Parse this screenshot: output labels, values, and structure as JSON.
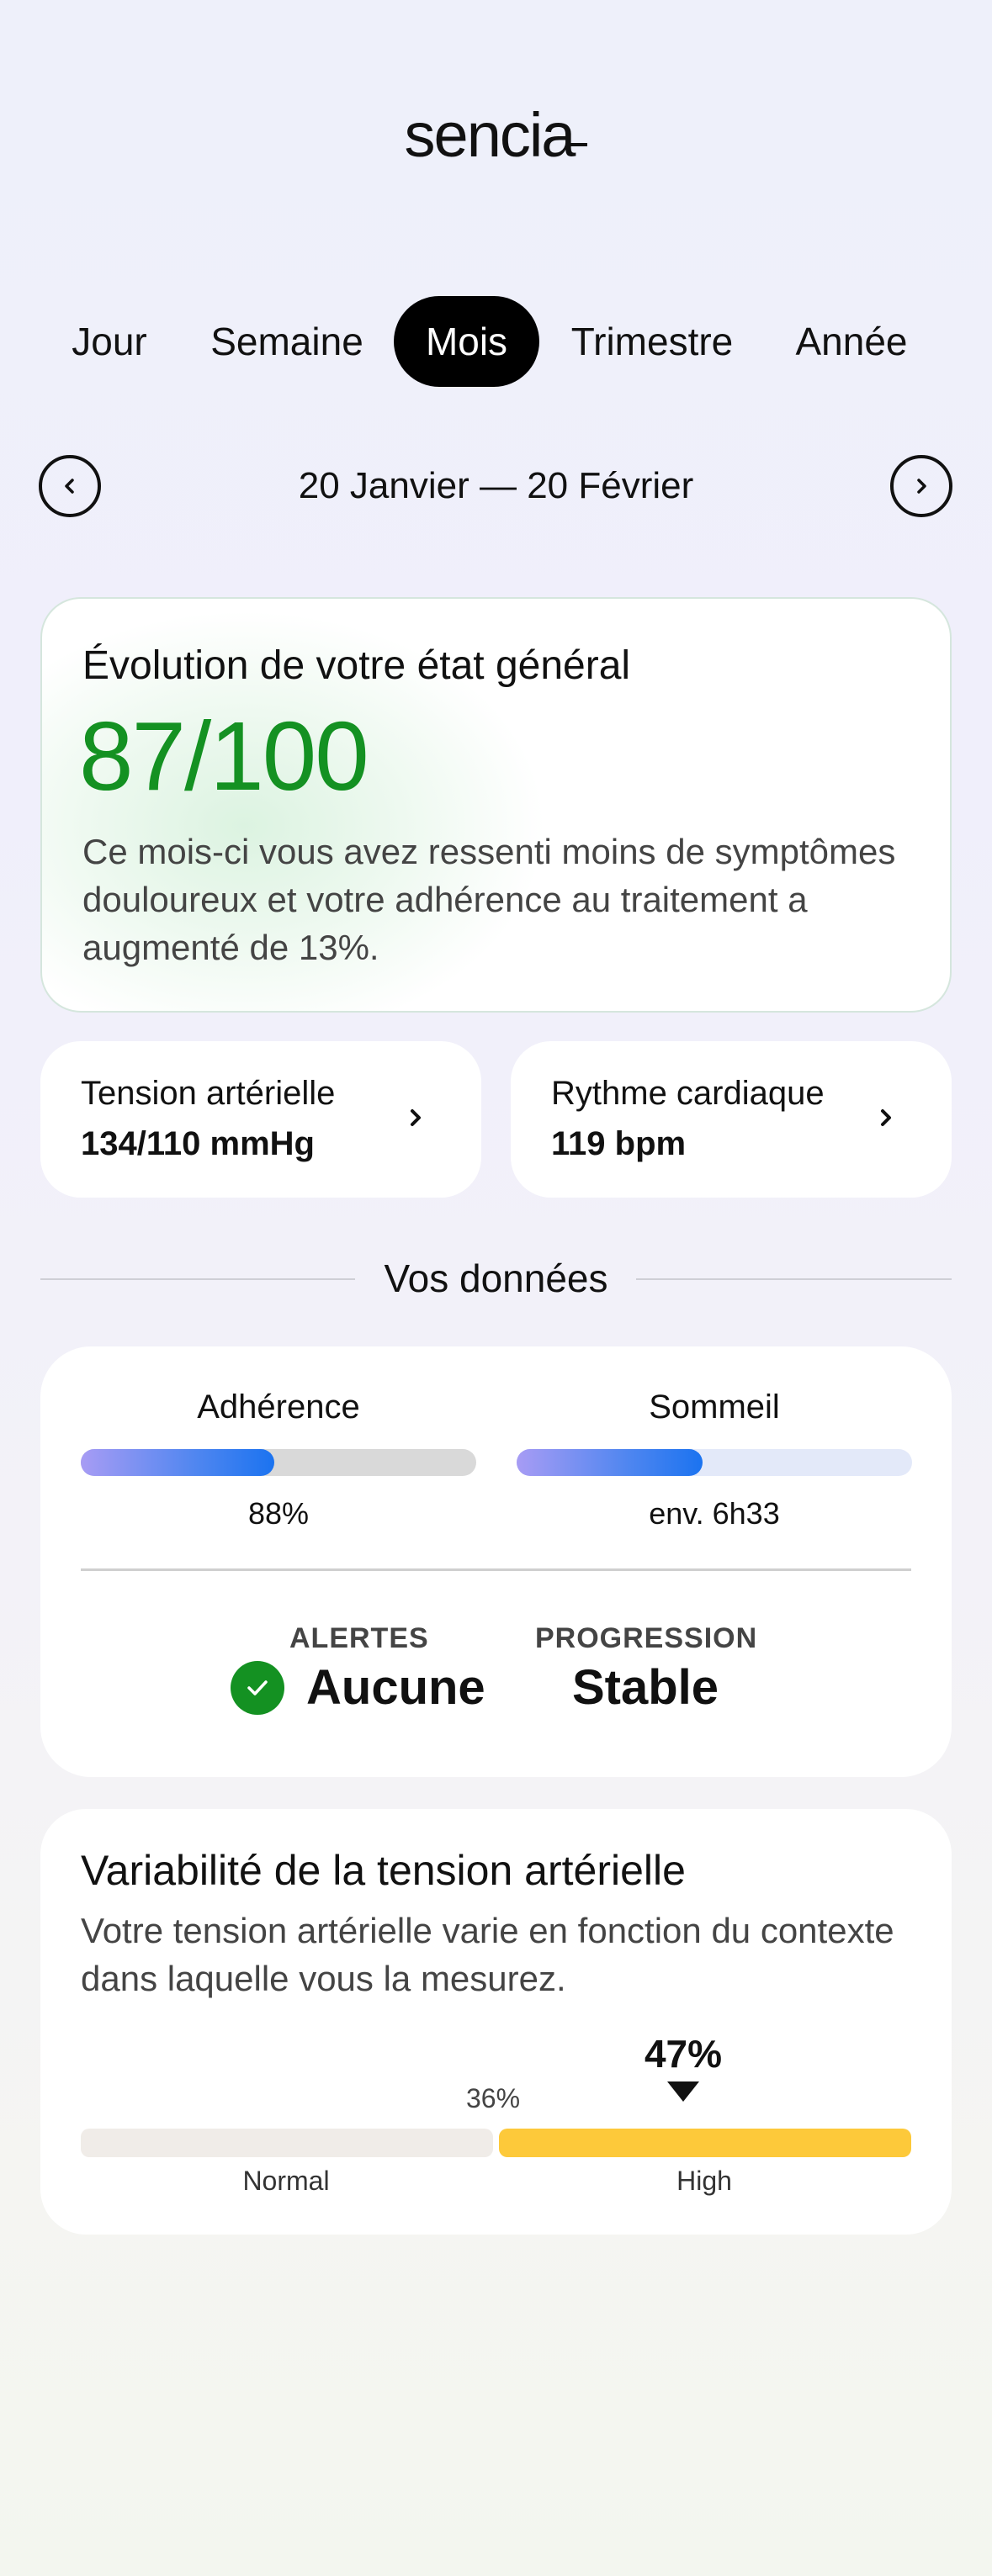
{
  "app": {
    "logo": "sencia"
  },
  "tabs": [
    {
      "label": "Jour",
      "active": false
    },
    {
      "label": "Semaine",
      "active": false
    },
    {
      "label": "Mois",
      "active": true
    },
    {
      "label": "Trimestre",
      "active": false
    },
    {
      "label": "Année",
      "active": false
    }
  ],
  "date_nav": {
    "range": "20 Janvier — 20 Février",
    "prev_icon": "chevron-left-icon",
    "next_icon": "chevron-right-icon"
  },
  "overview": {
    "title": "Évolution de votre état général",
    "score": "87/100",
    "description": "Ce mois-ci vous avez ressenti moins de symptômes douloureux et votre adhérence au traitement a augmenté de 13%.",
    "score_color": "#149122"
  },
  "vitals": [
    {
      "label": "Tension artérielle",
      "value": "134/110 mmHg"
    },
    {
      "label": "Rythme cardiaque",
      "value": "119 bpm"
    }
  ],
  "data_section": {
    "title": "Vos données",
    "adherence": {
      "label": "Adhérence",
      "value": "88%",
      "fill_fraction": 0.49
    },
    "sleep": {
      "label": "Sommeil",
      "value": "env. 6h33",
      "fill_fraction": 0.47
    },
    "alerts": {
      "label": "ALERTES",
      "value": "Aucune"
    },
    "progression": {
      "label": "PROGRESSION",
      "value": "Stable"
    }
  },
  "variability": {
    "title": "Variabilité de la tension artérielle",
    "description": "Votre tension artérielle varie en fonction du contexte dans laquelle vous la mesurez.",
    "current": "47%",
    "threshold": "36%",
    "segments": [
      {
        "label": "Normal",
        "color": "#f0ece8"
      },
      {
        "label": "High",
        "color": "#fdc93a"
      }
    ]
  }
}
